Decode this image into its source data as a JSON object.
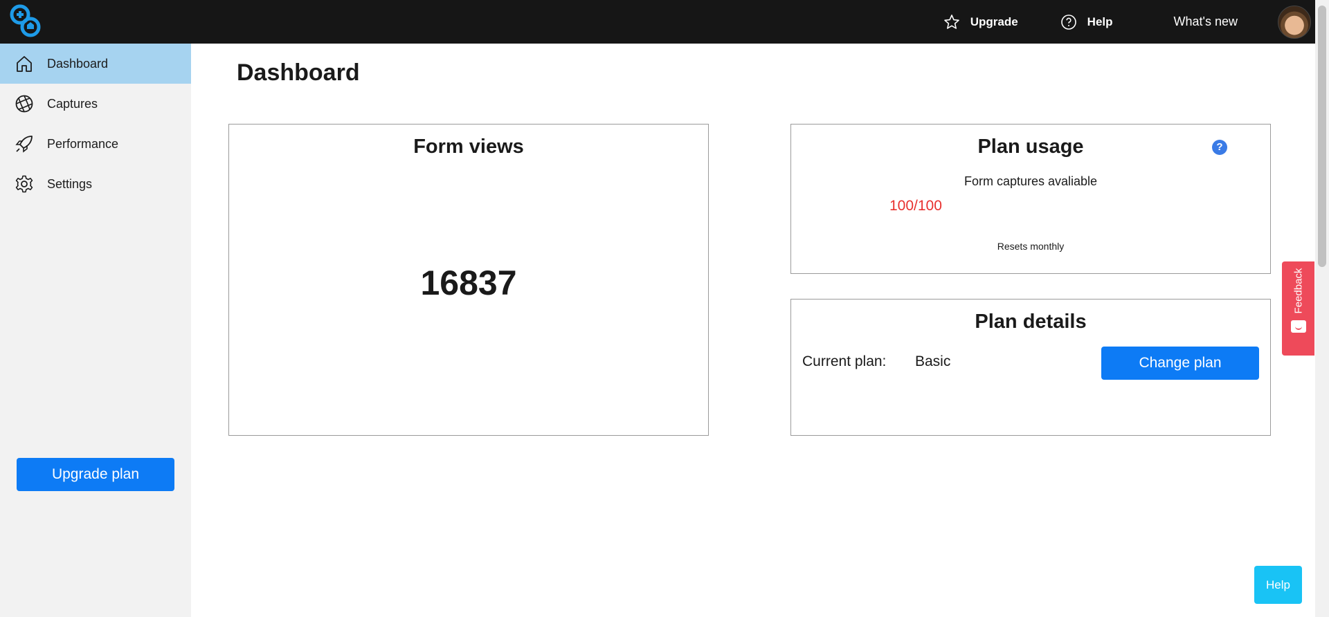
{
  "topbar": {
    "upgrade_label": "Upgrade",
    "help_label": "Help",
    "whatsnew_label": "What's new"
  },
  "sidebar": {
    "items": [
      {
        "label": "Dashboard",
        "icon": "home-icon",
        "active": true
      },
      {
        "label": "Captures",
        "icon": "aperture-icon",
        "active": false
      },
      {
        "label": "Performance",
        "icon": "rocket-icon",
        "active": false
      },
      {
        "label": "Settings",
        "icon": "gear-icon",
        "active": false
      }
    ],
    "upgrade_button": "Upgrade plan"
  },
  "main": {
    "title": "Dashboard",
    "form_views": {
      "title": "Form views",
      "value": "16837"
    },
    "plan_usage": {
      "title": "Plan usage",
      "help_symbol": "?",
      "captures_label": "Form captures avaliable",
      "captures_value": "100/100",
      "resets_text": "Resets monthly"
    },
    "plan_details": {
      "title": "Plan details",
      "current_plan_label": "Current plan:",
      "current_plan_value": "Basic",
      "change_button": "Change plan"
    }
  },
  "widgets": {
    "feedback_label": "Feedback",
    "help_button": "Help"
  },
  "colors": {
    "accent": "#0d7bf5",
    "topbar": "#161616",
    "sidebar_active": "#a6d3f0",
    "feedback": "#ee4a5a",
    "usage_value": "#e8312f",
    "help_float": "#19c3f5"
  }
}
